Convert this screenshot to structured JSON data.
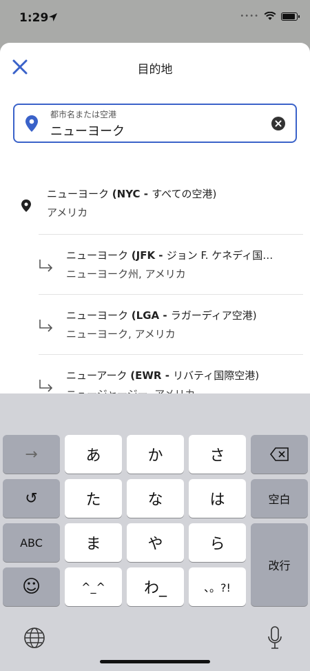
{
  "status": {
    "time": "1:29"
  },
  "sheet": {
    "title": "目的地",
    "search": {
      "label": "都市名または空港",
      "value": "ニューヨーク"
    },
    "results": [
      {
        "name": "ニューヨーク ",
        "code": "(NYC - ",
        "detail": "すべての空港)",
        "sub": "アメリカ"
      },
      {
        "name": "ニューヨーク ",
        "code": "(JFK - ",
        "detail": "ジョン F. ケネディ国…",
        "sub": "ニューヨーク州, アメリカ"
      },
      {
        "name": "ニューヨーク ",
        "code": "(LGA - ",
        "detail": "ラガーディア空港)",
        "sub": "ニューヨーク, アメリカ"
      },
      {
        "name": "ニューアーク ",
        "code": "(EWR - ",
        "detail": "リバティ国際空港)",
        "sub": "ニュージャージー, アメリカ"
      }
    ]
  },
  "keyboard": {
    "keys": {
      "arrow": "→",
      "a": "あ",
      "ka": "か",
      "sa": "さ",
      "undo": "↺",
      "ta": "た",
      "na": "な",
      "ha": "は",
      "space": "空白",
      "abc": "ABC",
      "ma": "ま",
      "ya": "や",
      "ra": "ら",
      "enter": "改行",
      "emoji": "☺",
      "kao": "^_^",
      "wa": "わ_",
      "punct": "、。?!"
    }
  }
}
